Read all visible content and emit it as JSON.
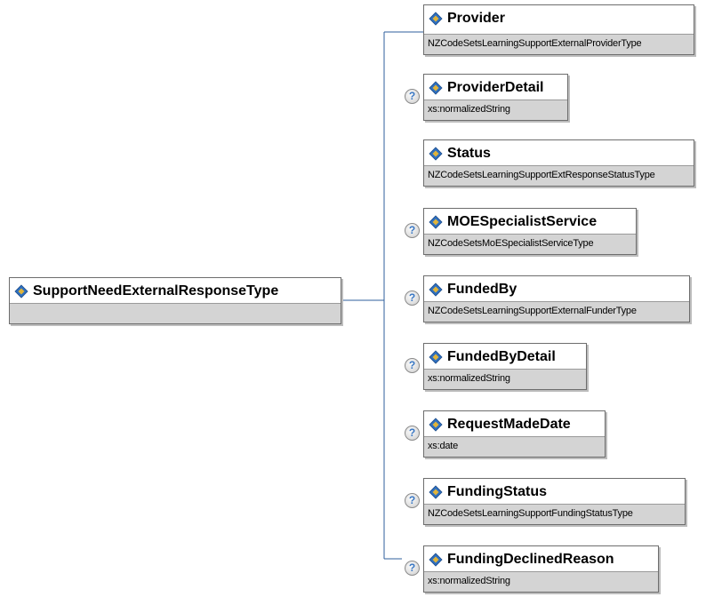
{
  "root": {
    "name": "SupportNeedExternalResponseType",
    "type": ""
  },
  "elements": [
    {
      "name": "Provider",
      "type": "NZCodeSetsLearningSupportExternalProviderType",
      "optional": false
    },
    {
      "name": "ProviderDetail",
      "type": "xs:normalizedString",
      "optional": true
    },
    {
      "name": "Status",
      "type": "NZCodeSetsLearningSupportExtResponseStatusType",
      "optional": false
    },
    {
      "name": "MOESpecialistService",
      "type": "NZCodeSetsMoESpecialistServiceType",
      "optional": true
    },
    {
      "name": "FundedBy",
      "type": "NZCodeSetsLearningSupportExternalFunderType",
      "optional": true
    },
    {
      "name": "FundedByDetail",
      "type": "xs:normalizedString",
      "optional": true
    },
    {
      "name": "RequestMadeDate",
      "type": "xs:date",
      "optional": true
    },
    {
      "name": "FundingStatus",
      "type": "NZCodeSetsLearningSupportFundingStatusType",
      "optional": true
    },
    {
      "name": "FundingDeclinedReason",
      "type": "xs:normalizedString",
      "optional": true
    }
  ],
  "optional_marker": "?",
  "colors": {
    "connector": "#2f5f9e",
    "type_band": "#d4d4d4",
    "icon_blue": "#2e6fc0",
    "icon_gold": "#e0b43a"
  }
}
